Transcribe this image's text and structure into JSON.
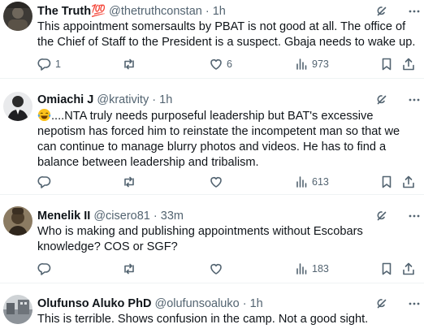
{
  "posts": [
    {
      "name": "The Truth💯",
      "handle": "@thetruthconstan",
      "sep": "·",
      "time": "1h",
      "text": "This appointment somersaults by PBAT is not good at all. The office of the Chief of Staff to the President is a suspect. Gbaja needs to wake up.",
      "replies": "1",
      "reposts": "",
      "likes": "6",
      "views": "973"
    },
    {
      "name": "Omiachi J",
      "handle": "@krativity",
      "sep": "·",
      "time": "1h",
      "emoji": "tears-of-joy",
      "text": "....NTA truly needs purposeful leadership but BAT's excessive nepotism has forced him to reinstate the incompetent man so that we can continue to manage blurry photos and videos. He has to find a balance between leadership and tribalism.",
      "replies": "",
      "reposts": "",
      "likes": "",
      "views": "613"
    },
    {
      "name": "Menelik II",
      "handle": "@cisero81",
      "sep": "·",
      "time": "33m",
      "text": "Who is making and publishing appointments without Escobars knowledge? COS or SGF?",
      "replies": "",
      "reposts": "",
      "likes": "",
      "views": "183"
    },
    {
      "name": "Olufunso Aluko PhD",
      "handle": "@olufunsoaluko",
      "sep": "·",
      "time": "1h",
      "text": "This is terrible. Shows confusion in the camp. Not a good sight."
    }
  ],
  "icons": {
    "reply": "reply-icon",
    "repost": "repost-icon",
    "like": "like-icon",
    "views": "views-icon",
    "bookmark": "bookmark-icon",
    "share": "share-icon",
    "grok": "grok-icon",
    "more": "more-icon"
  }
}
